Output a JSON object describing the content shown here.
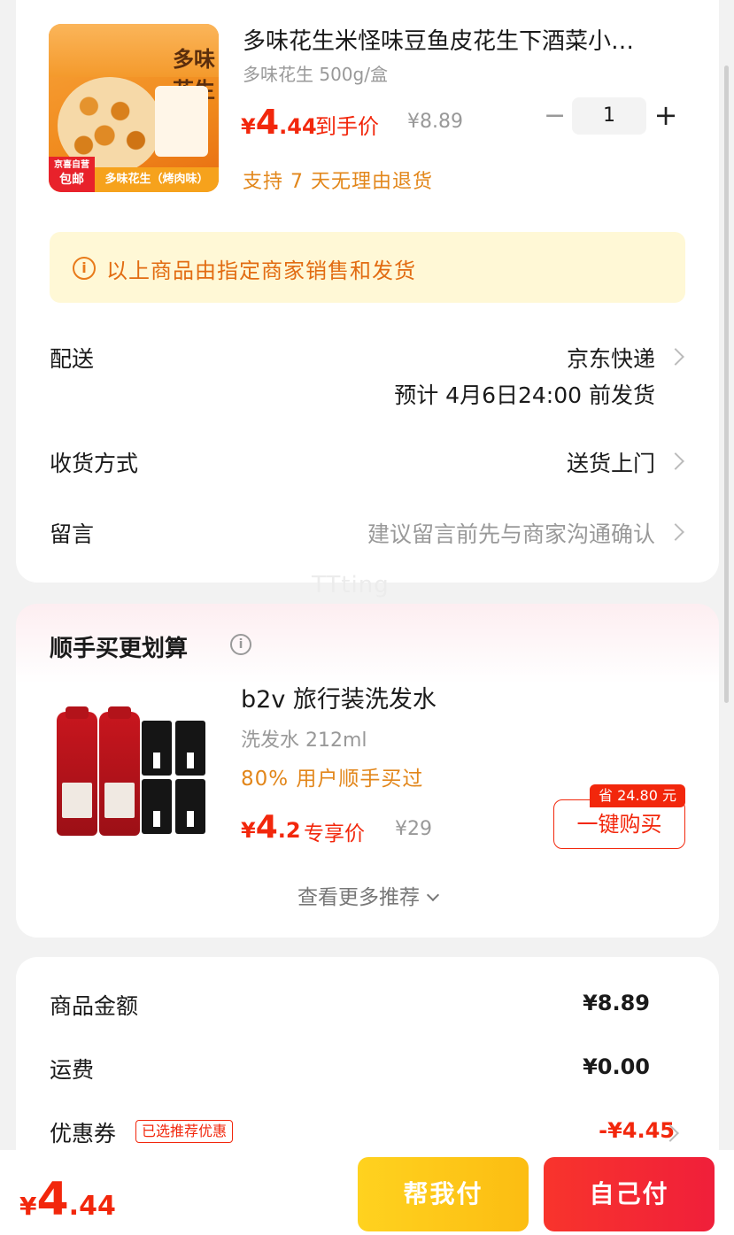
{
  "product": {
    "title": "多味花生米怪味豆鱼皮花生下酒菜小…",
    "spec": "多味花生 500g/盒",
    "price_currency": "¥",
    "price_int": "4",
    "price_dec": ".44",
    "price_label": "到手价",
    "original_price": "¥8.89",
    "quantity": "1",
    "minus": "−",
    "plus": "+",
    "return_policy": "支持 7 天无理由退货",
    "image": {
      "tag_jd": "京喜自营",
      "tag_free": "包邮",
      "tag_flavor": "多味花生（烤肉味）",
      "brand_text": "多味花生"
    }
  },
  "notice": {
    "icon": "i",
    "text": "以上商品由指定商家销售和发货"
  },
  "delivery": {
    "label": "配送",
    "value": "京东快递",
    "eta": "预计 4月6日24:00 前发货"
  },
  "receive": {
    "label": "收货方式",
    "value": "送货上门"
  },
  "message": {
    "label": "留言",
    "placeholder": "建议留言前先与商家沟通确认"
  },
  "watermark": "TTting",
  "recommend": {
    "title": "顺手买更划算",
    "info_icon": "i",
    "item": {
      "title": "b2v 旅行装洗发水",
      "spec": "洗发水 212ml",
      "percent_text": "80% 用户顺手买过",
      "price_currency": "¥",
      "price_int": "4",
      "price_dec": ".2",
      "price_label": "专享价",
      "original_price": "¥29",
      "save_badge": "省 24.80 元",
      "buy_label": "一键购买"
    },
    "more_label": "查看更多推荐"
  },
  "summary": {
    "goods_label": "商品金额",
    "goods_value": "¥8.89",
    "shipping_label": "运费",
    "shipping_value": "¥0.00",
    "coupon_label": "优惠券",
    "coupon_tag": "已选推荐优惠",
    "coupon_value": "-¥4.45"
  },
  "bottom": {
    "total_currency": "¥",
    "total_int": "4",
    "total_dec": ".44",
    "help_pay_label": "帮我付",
    "self_pay_label": "自己付"
  },
  "colors": {
    "accent_red": "#f2270c",
    "accent_orange": "#e2861a",
    "help_button": "#fcbd12",
    "self_button": "#f01f3a",
    "notice_bg": "#fff8d6"
  }
}
